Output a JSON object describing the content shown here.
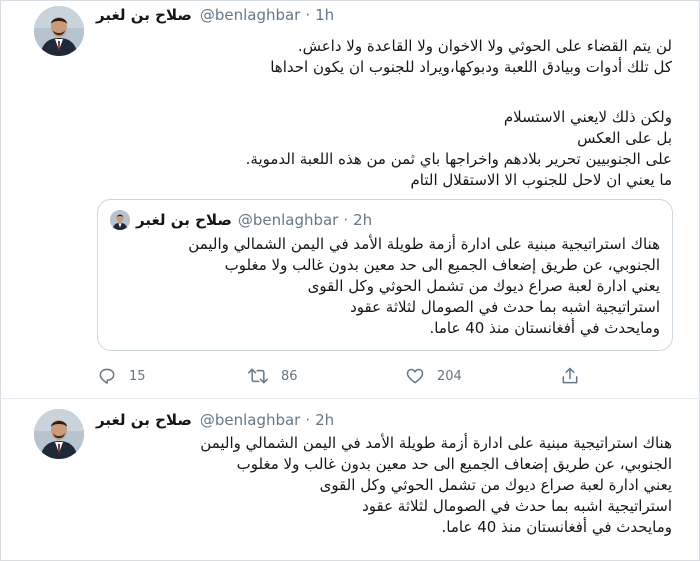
{
  "tweet_main": {
    "author": {
      "display_name": "صلاح بن لغبر",
      "handle": "@benlaghbar",
      "separator": "·",
      "time": "1h"
    },
    "body_lines": [
      "لن يتم القضاء على الحوثي ولا الاخوان ولا القاعدة ولا داعش.",
      "كل تلك أدوات وبيادق اللعبة ودبوكها،ويراد للجنوب ان يكون احداها",
      "",
      "ولكن ذلك لايعني الاستسلام",
      "بل على العكس",
      "على  الجنوبيين تحرير بلادهم واخراجها باي ثمن من هذه اللعبة الدموية.",
      "ما يعني ان لاحل للجنوب الا الاستقلال التام"
    ],
    "quoted": {
      "author": {
        "display_name": "صلاح بن لغبر",
        "handle": "@benlaghbar",
        "separator": "·",
        "time": "2h"
      },
      "body_lines": [
        "هناك استراتيجية مبنية على ادارة  أزمة طويلة الأمد في اليمن الشمالي واليمن",
        "الجنوبي، عن طريق إضعاف الجميع الى حد معين بدون غالب ولا مغلوب",
        "يعني ادارة لعبة صراع ديوك من تشمل الحوثي وكل القوى",
        "استراتيجية اشبه بما حدث في الصومال لثلاثة عقود",
        "ومايحدث في أفغانستان منذ 40 عاما."
      ]
    },
    "actions": {
      "reply": {
        "icon": "reply-icon",
        "count": "15"
      },
      "retweet": {
        "icon": "retweet-icon",
        "count": "86"
      },
      "like": {
        "icon": "heart-icon",
        "count": "204"
      },
      "share": {
        "icon": "share-icon"
      }
    }
  },
  "tweet_second": {
    "author": {
      "display_name": "صلاح بن لغبر",
      "handle": "@benlaghbar",
      "separator": "·",
      "time": "2h"
    },
    "body_lines": [
      "هناك استراتيجية مبنية على ادارة  أزمة طويلة الأمد في اليمن الشمالي واليمن",
      "الجنوبي، عن طريق إضعاف الجميع الى حد معين بدون غالب ولا مغلوب",
      "يعني ادارة لعبة صراع ديوك من تشمل الحوثي وكل القوى",
      "استراتيجية اشبه بما حدث في الصومال لثلاثة عقود",
      "ومايحدث في أفغانستان منذ 40 عاما."
    ]
  },
  "colors": {
    "text": "#14171a",
    "secondary": "#657786",
    "border": "#ccd6dd"
  }
}
